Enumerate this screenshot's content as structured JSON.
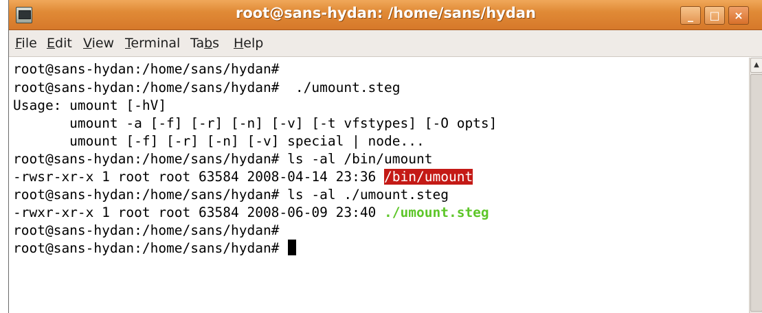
{
  "window": {
    "title": "root@sans-hydan: /home/sans/hydan",
    "buttons": {
      "minimize": "_",
      "maximize": "□",
      "close": "×"
    }
  },
  "menubar": [
    {
      "label": "File",
      "mnemonic": "F",
      "rest": "ile"
    },
    {
      "label": "Edit",
      "mnemonic": "E",
      "rest": "dit"
    },
    {
      "label": "View",
      "mnemonic": "V",
      "rest": "iew"
    },
    {
      "label": "Terminal",
      "mnemonic": "T",
      "rest": "erminal"
    },
    {
      "label": "Tabs",
      "pre": "Ta",
      "mnemonic": "b",
      "rest": "s"
    },
    {
      "label": "Help",
      "mnemonic": "H",
      "rest": "elp"
    }
  ],
  "terminal": {
    "lines": [
      "root@sans-hydan:/home/sans/hydan#",
      "root@sans-hydan:/home/sans/hydan#  ./umount.steg",
      "Usage: umount [-hV]",
      "       umount -a [-f] [-r] [-n] [-v] [-t vfstypes] [-O opts]",
      "       umount [-f] [-r] [-n] [-v] special | node...",
      "root@sans-hydan:/home/sans/hydan# ls -al /bin/umount",
      {
        "prefix": "-rwsr-xr-x 1 root root 63584 2008-04-14 23:36 ",
        "highlight": "/bin/umount"
      },
      "root@sans-hydan:/home/sans/hydan# ls -al ./umount.steg",
      {
        "prefix": "-rwxr-xr-x 1 root root 63584 2008-06-09 23:40 ",
        "highlight": "./umount.steg"
      },
      "root@sans-hydan:/home/sans/hydan#",
      "root@sans-hydan:/home/sans/hydan# "
    ]
  },
  "scrollbar": {
    "up_arrow": "▲"
  }
}
